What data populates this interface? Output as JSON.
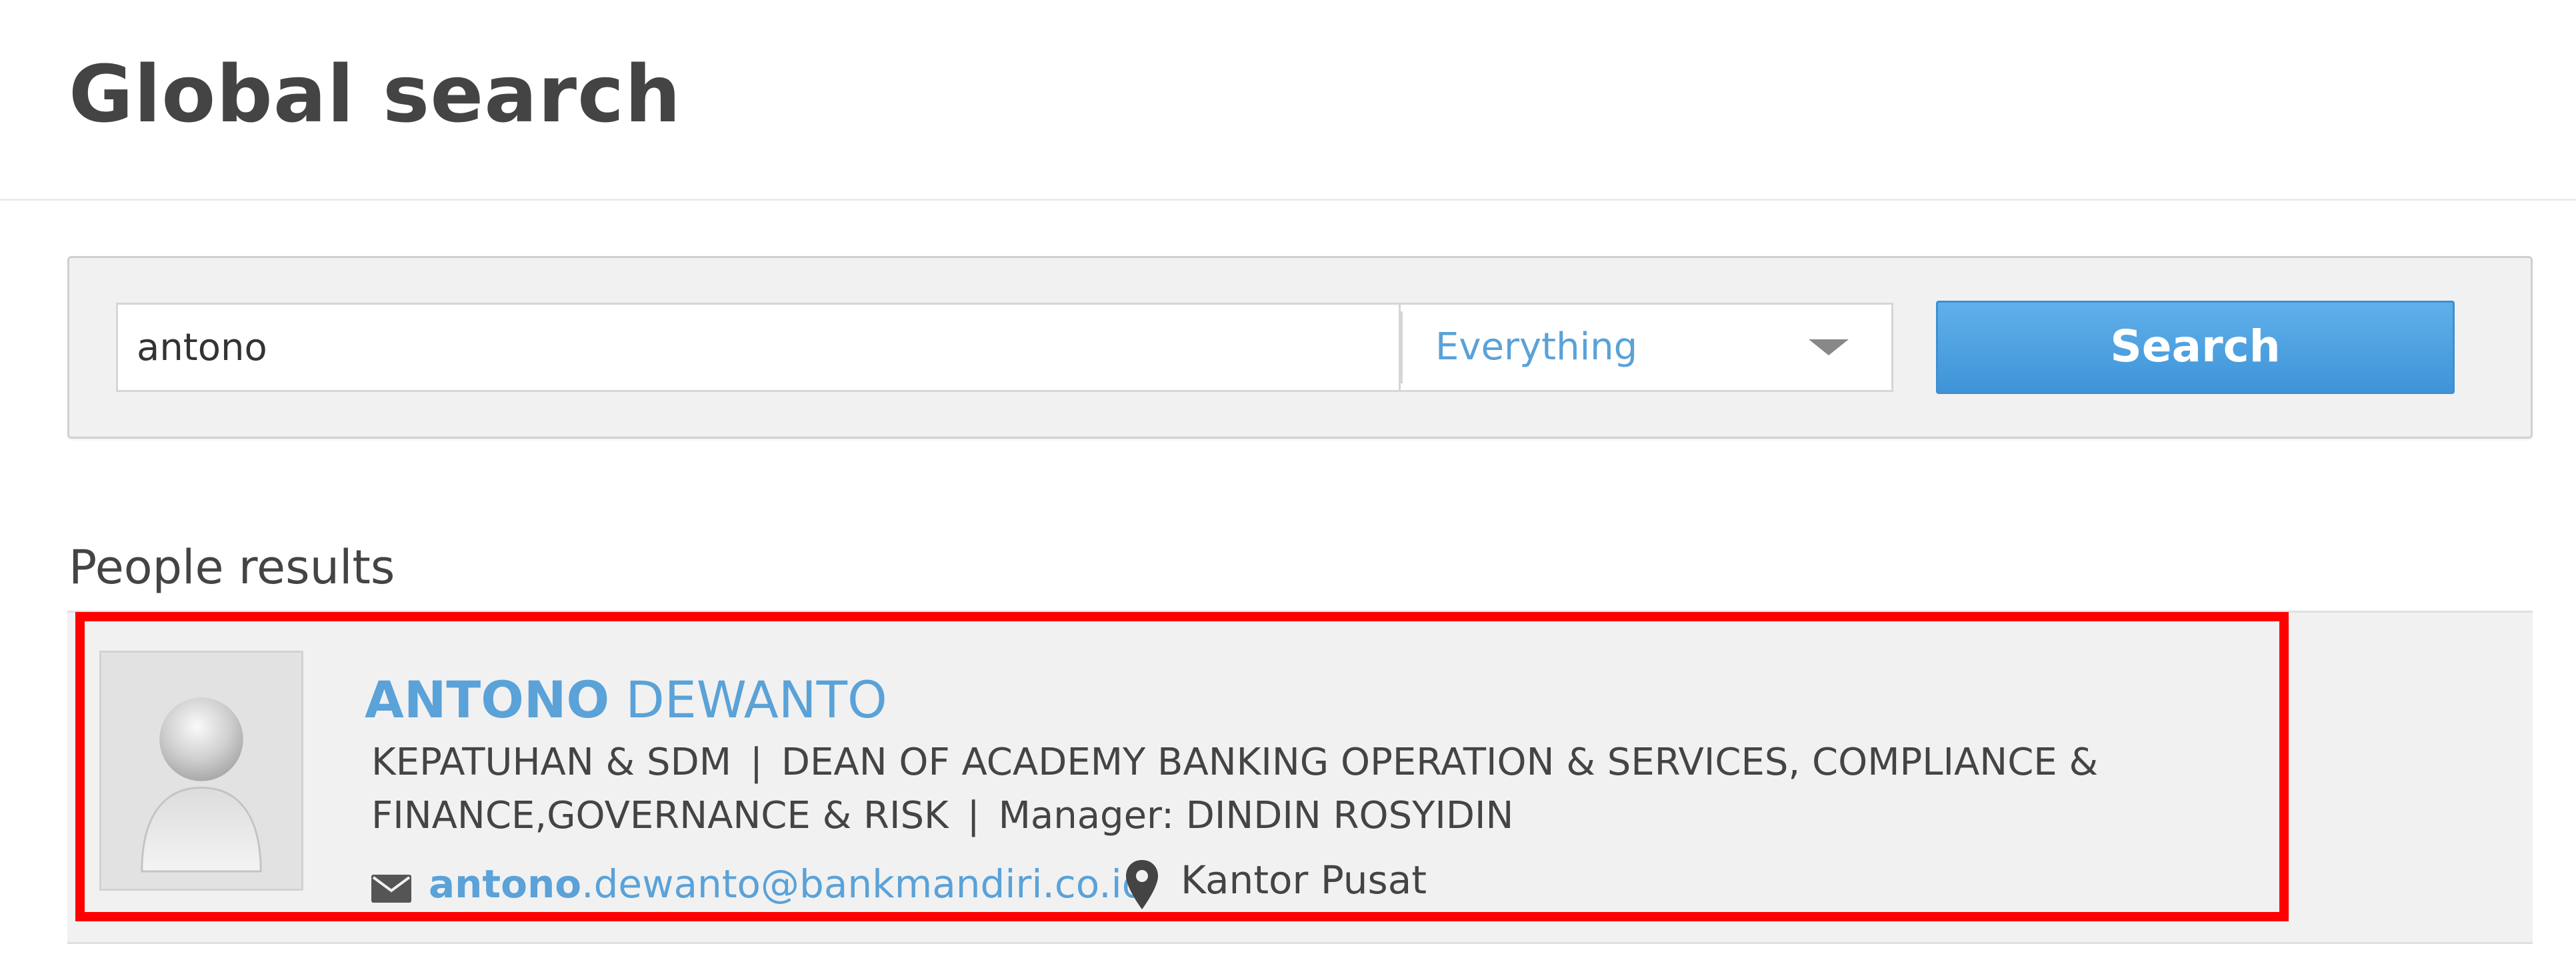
{
  "page": {
    "title": "Global search"
  },
  "search": {
    "query": "antono",
    "scope": "Everything",
    "button_label": "Search"
  },
  "results": {
    "heading": "People results",
    "people": [
      {
        "name_match": "ANTONO",
        "name_rest": " DEWANTO",
        "department": "KEPATUHAN & SDM",
        "title": "DEAN OF ACADEMY BANKING OPERATION & SERVICES, COMPLIANCE & FINANCE,GOVERNANCE & RISK",
        "manager": "Manager: DINDIN ROSYIDIN",
        "separator": "|",
        "email_match": "antono",
        "email_rest": ".dewanto@bankmandiri.co.id",
        "location": "Kantor Pusat",
        "avatar_icon": "default-person-icon",
        "email_icon": "envelope-icon",
        "location_icon": "map-pin-icon"
      }
    ]
  },
  "colors": {
    "accent": "#5aa2d8",
    "button_top": "#5fb0ea",
    "button_bottom": "#3f94d8",
    "highlight_border": "#ff0000",
    "panel_background": "#f1f1f1",
    "text": "#444444"
  }
}
